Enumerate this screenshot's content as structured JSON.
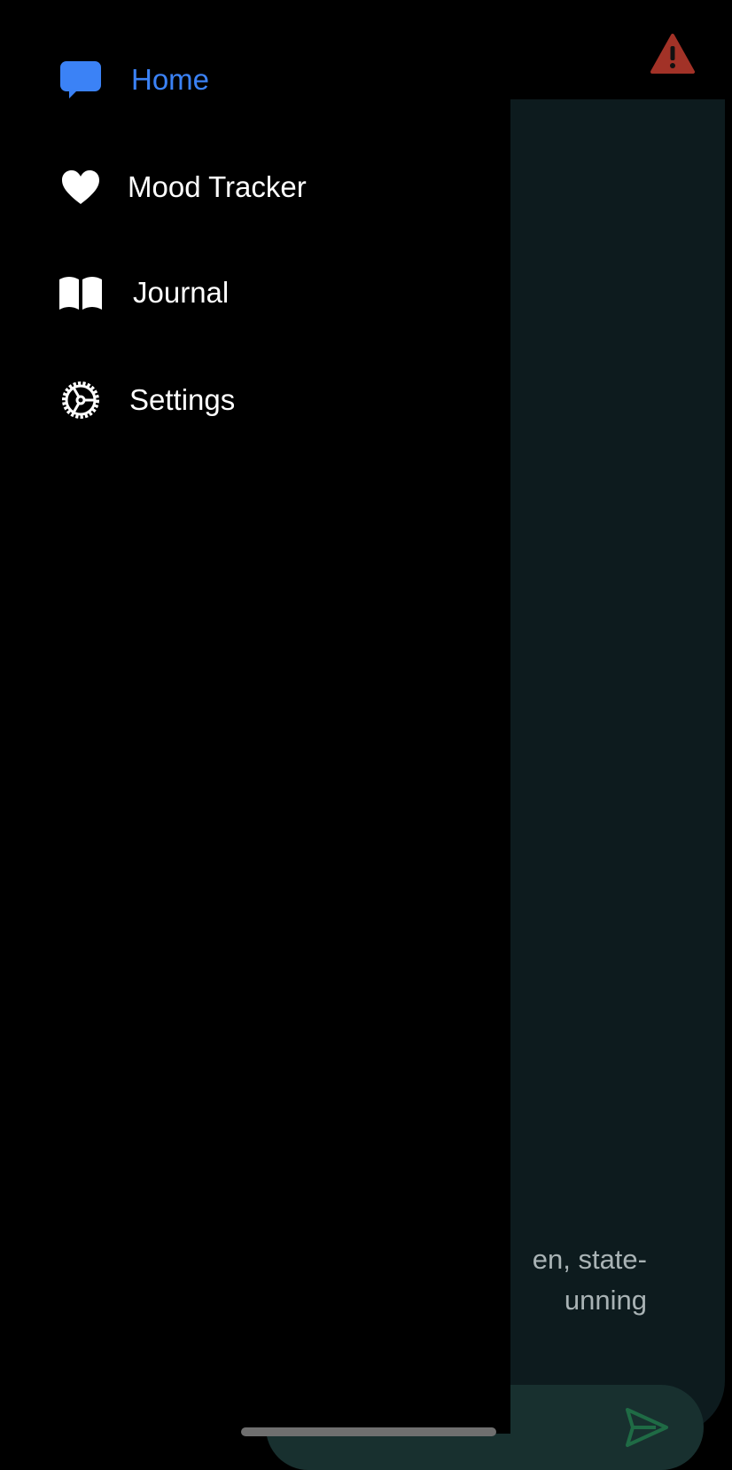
{
  "main": {
    "message_line1": "en, state-",
    "message_line2": "unning",
    "colors": {
      "panel": "#0d1b1e",
      "input": "#18302f",
      "send": "#1f6b45",
      "alert": "#c0392b"
    },
    "send_icon": "send-icon",
    "alert_icon": "warning-icon"
  },
  "drawer": {
    "items": [
      {
        "label": "Home",
        "icon": "chat-bubble-icon",
        "active": true
      },
      {
        "label": "Mood Tracker",
        "icon": "heart-icon",
        "active": false
      },
      {
        "label": "Journal",
        "icon": "book-icon",
        "active": false
      },
      {
        "label": "Settings",
        "icon": "gear-icon",
        "active": false
      }
    ],
    "colors": {
      "active": "#3b82f6",
      "inactive": "#ffffff"
    }
  }
}
